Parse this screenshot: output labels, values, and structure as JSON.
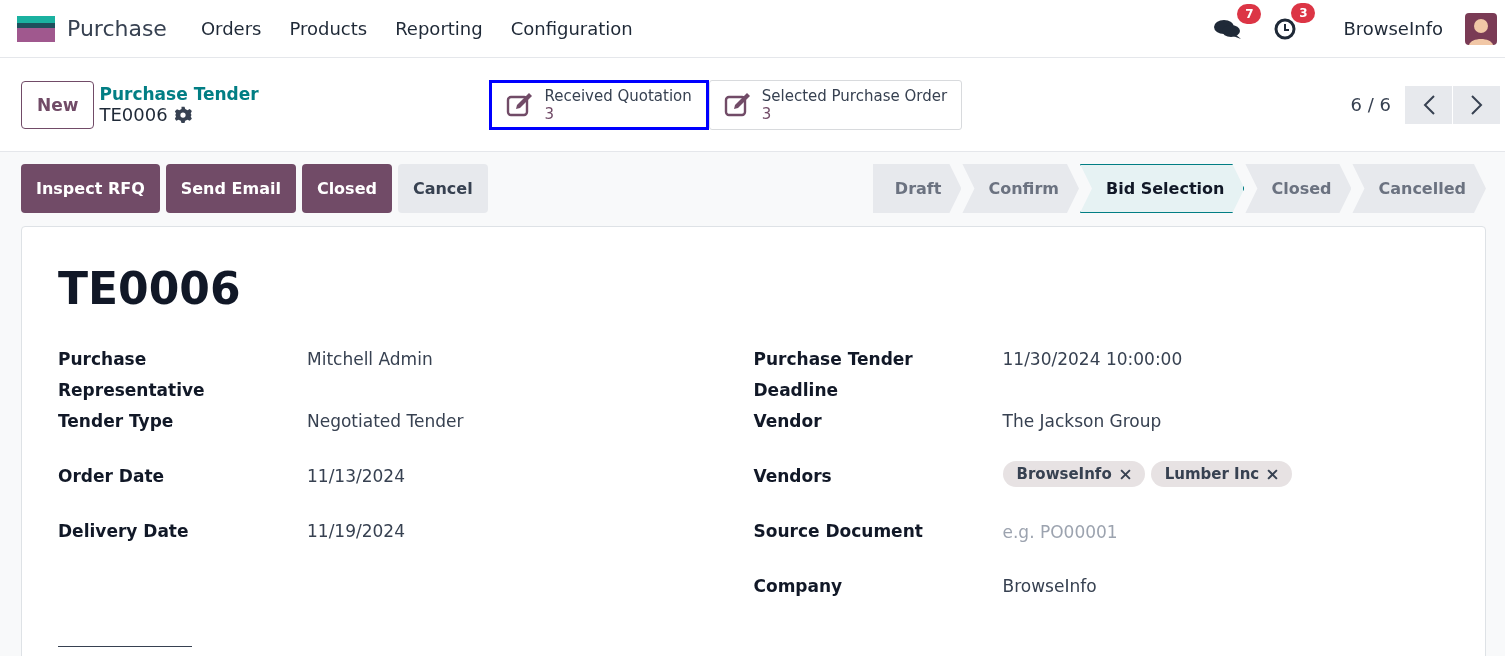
{
  "navbar": {
    "app": "Purchase",
    "menu": [
      "Orders",
      "Products",
      "Reporting",
      "Configuration"
    ],
    "messages_badge": "7",
    "activities_badge": "3",
    "user": "BrowseInfo"
  },
  "control": {
    "new_button": "New",
    "breadcrumb": "Purchase Tender",
    "record": "TE0006",
    "smart_buttons": [
      {
        "label": "Received Quotation",
        "count": "3",
        "highlighted": true
      },
      {
        "label": "Selected Purchase Order",
        "count": "3",
        "highlighted": false
      }
    ],
    "pager": "6 / 6"
  },
  "actions": [
    {
      "label": "Inspect RFQ",
      "kind": "primary"
    },
    {
      "label": "Send Email",
      "kind": "primary"
    },
    {
      "label": "Closed",
      "kind": "primary"
    },
    {
      "label": "Cancel",
      "kind": "secondary"
    }
  ],
  "statusbar": [
    {
      "label": "Draft",
      "selected": false
    },
    {
      "label": "Confirm",
      "selected": false
    },
    {
      "label": "Bid Selection",
      "selected": true
    },
    {
      "label": "Closed",
      "selected": false
    },
    {
      "label": "Cancelled",
      "selected": false
    }
  ],
  "form": {
    "title": "TE0006",
    "left": [
      {
        "label": "Purchase Representative",
        "value": "Mitchell Admin"
      },
      {
        "label": "Tender Type",
        "value": "Negotiated Tender"
      },
      {
        "label": "Order Date",
        "value": "11/13/2024"
      },
      {
        "label": "Delivery Date",
        "value": "11/19/2024"
      }
    ],
    "right": [
      {
        "label": "Purchase Tender Deadline",
        "kind": "text",
        "value": "11/30/2024 10:00:00"
      },
      {
        "label": "Vendor",
        "kind": "text",
        "value": "The Jackson Group"
      },
      {
        "label": "Vendors",
        "kind": "tags",
        "tags": [
          "BrowseInfo",
          "Lumber Inc"
        ]
      },
      {
        "label": "Source Document",
        "kind": "placeholder",
        "placeholder": "e.g. PO00001"
      },
      {
        "label": "Company",
        "kind": "text",
        "value": "BrowseInfo"
      }
    ]
  }
}
